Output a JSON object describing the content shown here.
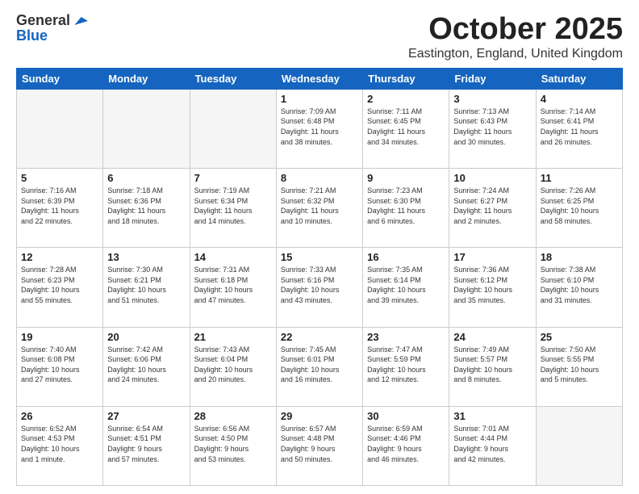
{
  "logo": {
    "general": "General",
    "blue": "Blue"
  },
  "header": {
    "month": "October 2025",
    "location": "Eastington, England, United Kingdom"
  },
  "days_of_week": [
    "Sunday",
    "Monday",
    "Tuesday",
    "Wednesday",
    "Thursday",
    "Friday",
    "Saturday"
  ],
  "weeks": [
    [
      {
        "day": "",
        "info": ""
      },
      {
        "day": "",
        "info": ""
      },
      {
        "day": "",
        "info": ""
      },
      {
        "day": "1",
        "info": "Sunrise: 7:09 AM\nSunset: 6:48 PM\nDaylight: 11 hours\nand 38 minutes."
      },
      {
        "day": "2",
        "info": "Sunrise: 7:11 AM\nSunset: 6:45 PM\nDaylight: 11 hours\nand 34 minutes."
      },
      {
        "day": "3",
        "info": "Sunrise: 7:13 AM\nSunset: 6:43 PM\nDaylight: 11 hours\nand 30 minutes."
      },
      {
        "day": "4",
        "info": "Sunrise: 7:14 AM\nSunset: 6:41 PM\nDaylight: 11 hours\nand 26 minutes."
      }
    ],
    [
      {
        "day": "5",
        "info": "Sunrise: 7:16 AM\nSunset: 6:39 PM\nDaylight: 11 hours\nand 22 minutes."
      },
      {
        "day": "6",
        "info": "Sunrise: 7:18 AM\nSunset: 6:36 PM\nDaylight: 11 hours\nand 18 minutes."
      },
      {
        "day": "7",
        "info": "Sunrise: 7:19 AM\nSunset: 6:34 PM\nDaylight: 11 hours\nand 14 minutes."
      },
      {
        "day": "8",
        "info": "Sunrise: 7:21 AM\nSunset: 6:32 PM\nDaylight: 11 hours\nand 10 minutes."
      },
      {
        "day": "9",
        "info": "Sunrise: 7:23 AM\nSunset: 6:30 PM\nDaylight: 11 hours\nand 6 minutes."
      },
      {
        "day": "10",
        "info": "Sunrise: 7:24 AM\nSunset: 6:27 PM\nDaylight: 11 hours\nand 2 minutes."
      },
      {
        "day": "11",
        "info": "Sunrise: 7:26 AM\nSunset: 6:25 PM\nDaylight: 10 hours\nand 58 minutes."
      }
    ],
    [
      {
        "day": "12",
        "info": "Sunrise: 7:28 AM\nSunset: 6:23 PM\nDaylight: 10 hours\nand 55 minutes."
      },
      {
        "day": "13",
        "info": "Sunrise: 7:30 AM\nSunset: 6:21 PM\nDaylight: 10 hours\nand 51 minutes."
      },
      {
        "day": "14",
        "info": "Sunrise: 7:31 AM\nSunset: 6:18 PM\nDaylight: 10 hours\nand 47 minutes."
      },
      {
        "day": "15",
        "info": "Sunrise: 7:33 AM\nSunset: 6:16 PM\nDaylight: 10 hours\nand 43 minutes."
      },
      {
        "day": "16",
        "info": "Sunrise: 7:35 AM\nSunset: 6:14 PM\nDaylight: 10 hours\nand 39 minutes."
      },
      {
        "day": "17",
        "info": "Sunrise: 7:36 AM\nSunset: 6:12 PM\nDaylight: 10 hours\nand 35 minutes."
      },
      {
        "day": "18",
        "info": "Sunrise: 7:38 AM\nSunset: 6:10 PM\nDaylight: 10 hours\nand 31 minutes."
      }
    ],
    [
      {
        "day": "19",
        "info": "Sunrise: 7:40 AM\nSunset: 6:08 PM\nDaylight: 10 hours\nand 27 minutes."
      },
      {
        "day": "20",
        "info": "Sunrise: 7:42 AM\nSunset: 6:06 PM\nDaylight: 10 hours\nand 24 minutes."
      },
      {
        "day": "21",
        "info": "Sunrise: 7:43 AM\nSunset: 6:04 PM\nDaylight: 10 hours\nand 20 minutes."
      },
      {
        "day": "22",
        "info": "Sunrise: 7:45 AM\nSunset: 6:01 PM\nDaylight: 10 hours\nand 16 minutes."
      },
      {
        "day": "23",
        "info": "Sunrise: 7:47 AM\nSunset: 5:59 PM\nDaylight: 10 hours\nand 12 minutes."
      },
      {
        "day": "24",
        "info": "Sunrise: 7:49 AM\nSunset: 5:57 PM\nDaylight: 10 hours\nand 8 minutes."
      },
      {
        "day": "25",
        "info": "Sunrise: 7:50 AM\nSunset: 5:55 PM\nDaylight: 10 hours\nand 5 minutes."
      }
    ],
    [
      {
        "day": "26",
        "info": "Sunrise: 6:52 AM\nSunset: 4:53 PM\nDaylight: 10 hours\nand 1 minute."
      },
      {
        "day": "27",
        "info": "Sunrise: 6:54 AM\nSunset: 4:51 PM\nDaylight: 9 hours\nand 57 minutes."
      },
      {
        "day": "28",
        "info": "Sunrise: 6:56 AM\nSunset: 4:50 PM\nDaylight: 9 hours\nand 53 minutes."
      },
      {
        "day": "29",
        "info": "Sunrise: 6:57 AM\nSunset: 4:48 PM\nDaylight: 9 hours\nand 50 minutes."
      },
      {
        "day": "30",
        "info": "Sunrise: 6:59 AM\nSunset: 4:46 PM\nDaylight: 9 hours\nand 46 minutes."
      },
      {
        "day": "31",
        "info": "Sunrise: 7:01 AM\nSunset: 4:44 PM\nDaylight: 9 hours\nand 42 minutes."
      },
      {
        "day": "",
        "info": ""
      }
    ]
  ]
}
